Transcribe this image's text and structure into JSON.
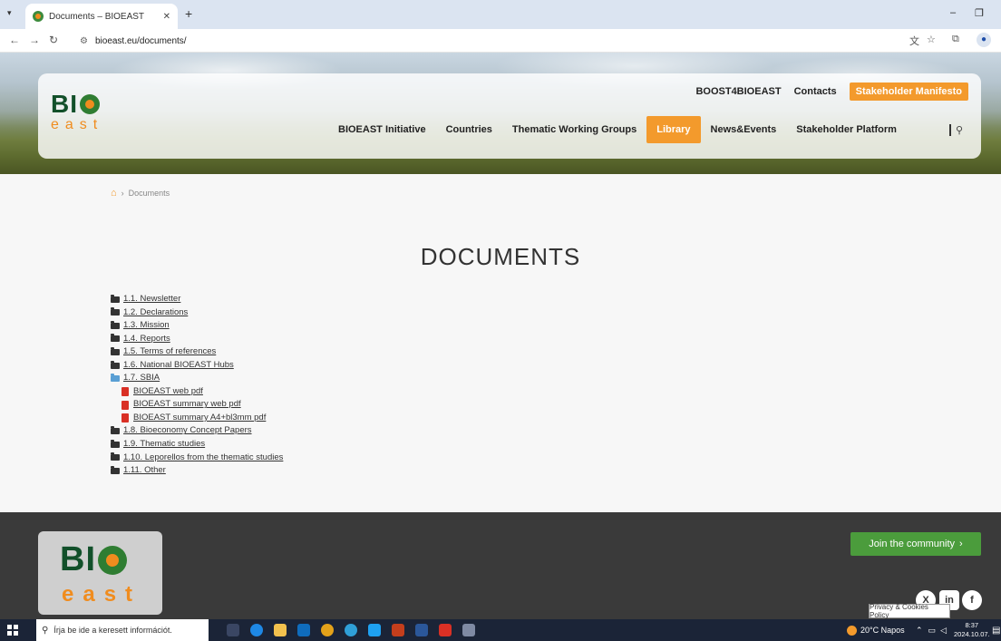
{
  "browser": {
    "tab_title": "Documents – BIOEAST",
    "close_tab_glyph": "✕",
    "new_tab_glyph": "+",
    "url": "bioeast.eu/documents/",
    "minimize_glyph": "–",
    "restore_glyph": "❐"
  },
  "header": {
    "logo_bio": "BI",
    "logo_east": "east",
    "top_links": {
      "boost": "BOOST4BIOEAST",
      "contacts": "Contacts",
      "manifesto": "Stakeholder Manifesto"
    },
    "nav": {
      "initiative": "BIOEAST Initiative",
      "countries": "Countries",
      "groups": "Thematic Working Groups",
      "library": "Library",
      "news": "News&Events",
      "platform": "Stakeholder Platform"
    }
  },
  "breadcrumb": {
    "separator": "›",
    "current": "Documents"
  },
  "page": {
    "title": "DOCUMENTS"
  },
  "documents": {
    "items": [
      {
        "label": "1.1. Newsletter"
      },
      {
        "label": "1.2. Declarations"
      },
      {
        "label": "1.3. Mission"
      },
      {
        "label": "1.4. Reports"
      },
      {
        "label": "1.5. Terms of references"
      },
      {
        "label": "1.6. National BIOEAST Hubs"
      },
      {
        "label": "1.7. SBIA"
      },
      {
        "label": "BIOEAST web pdf"
      },
      {
        "label": "BIOEAST summary web pdf"
      },
      {
        "label": "BIOEAST summary A4+bl3mm pdf"
      },
      {
        "label": "1.8. Bioeconomy Concept Papers"
      },
      {
        "label": "1.9. Thematic studies"
      },
      {
        "label": "1.10. Leporellos from the thematic studies"
      },
      {
        "label": "1.11. Other"
      }
    ]
  },
  "footer": {
    "logo_bio": "BI",
    "logo_east": "east",
    "join_label": "Join the community",
    "join_arrow": "›",
    "social": {
      "x": "X",
      "linkedin": "in",
      "facebook": "f"
    },
    "cookie_tooltip": "Privacy & Cookies Policy"
  },
  "taskbar": {
    "search_placeholder": "Írja be ide a keresett információt.",
    "weather": "20°C Napos",
    "time": "8:37",
    "date": "2024.10.07."
  },
  "colors": {
    "accent_orange": "#f39a2c",
    "brand_green": "#12502a",
    "join_green": "#4b9c3c",
    "footer_bg": "#3a3a3a"
  }
}
